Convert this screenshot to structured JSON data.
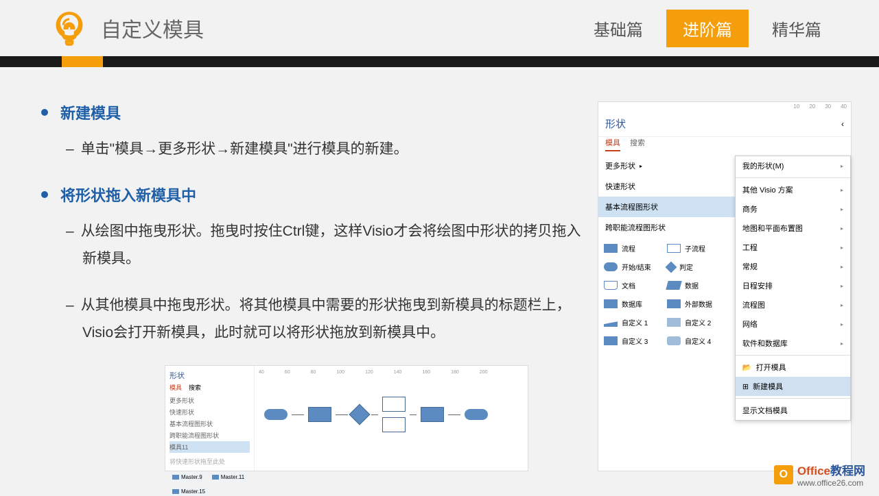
{
  "header": {
    "title": "自定义模具",
    "tabs": [
      "基础篇",
      "进阶篇",
      "精华篇"
    ],
    "active_tab": 1
  },
  "sections": [
    {
      "title": "新建模具",
      "items": [
        "单击\"模具→更多形状→新建模具\"进行模具的新建。"
      ]
    },
    {
      "title": "将形状拖入新模具中",
      "items": [
        "从绘图中拖曳形状。拖曳时按住Ctrl键，这样Visio才会将绘图中形状的拷贝拖入新模具。",
        "从其他模具中拖曳形状。将其他模具中需要的形状拖曳到新模具的标题栏上，Visio会打开新模具，此时就可以将形状拖放到新模具中。"
      ]
    }
  ],
  "panel": {
    "title": "形状",
    "chevron": "‹",
    "tabs": [
      "模具",
      "搜索"
    ],
    "list": [
      "更多形状",
      "快速形状",
      "基本流程图形状",
      "跨职能流程图形状"
    ],
    "shapes": [
      "流程",
      "子流程",
      "开始/结束",
      "判定",
      "文档",
      "数据",
      "数据库",
      "外部数据",
      "自定义 1",
      "自定义 2",
      "自定义 3",
      "自定义 4"
    ],
    "menu_top": [
      "我的形状(M)",
      "其他 Visio 方案",
      "商务",
      "地图和平面布置图",
      "工程",
      "常规",
      "日程安排",
      "流程图",
      "网络",
      "软件和数据库"
    ],
    "menu_bottom": [
      "打开模具",
      "新建模具",
      "显示文档模具"
    ],
    "menu_selected": "新建模具",
    "ruler": [
      "10",
      "20",
      "30",
      "40"
    ]
  },
  "lower": {
    "title": "形状",
    "tabs": [
      "模具",
      "搜索"
    ],
    "list": [
      "更多形状",
      "快速形状",
      "基本流程图形状",
      "跨职能流程图形状",
      "模具11"
    ],
    "hint": "将快速形状拖至此处",
    "masters": [
      "Master.9",
      "Master.11",
      "Master.15"
    ],
    "ruler": [
      "40",
      "60",
      "80",
      "100",
      "120",
      "140",
      "160",
      "180",
      "200"
    ]
  },
  "watermark": {
    "brand1": "Office",
    "brand2": "教程网",
    "url": "www.office26.com"
  }
}
